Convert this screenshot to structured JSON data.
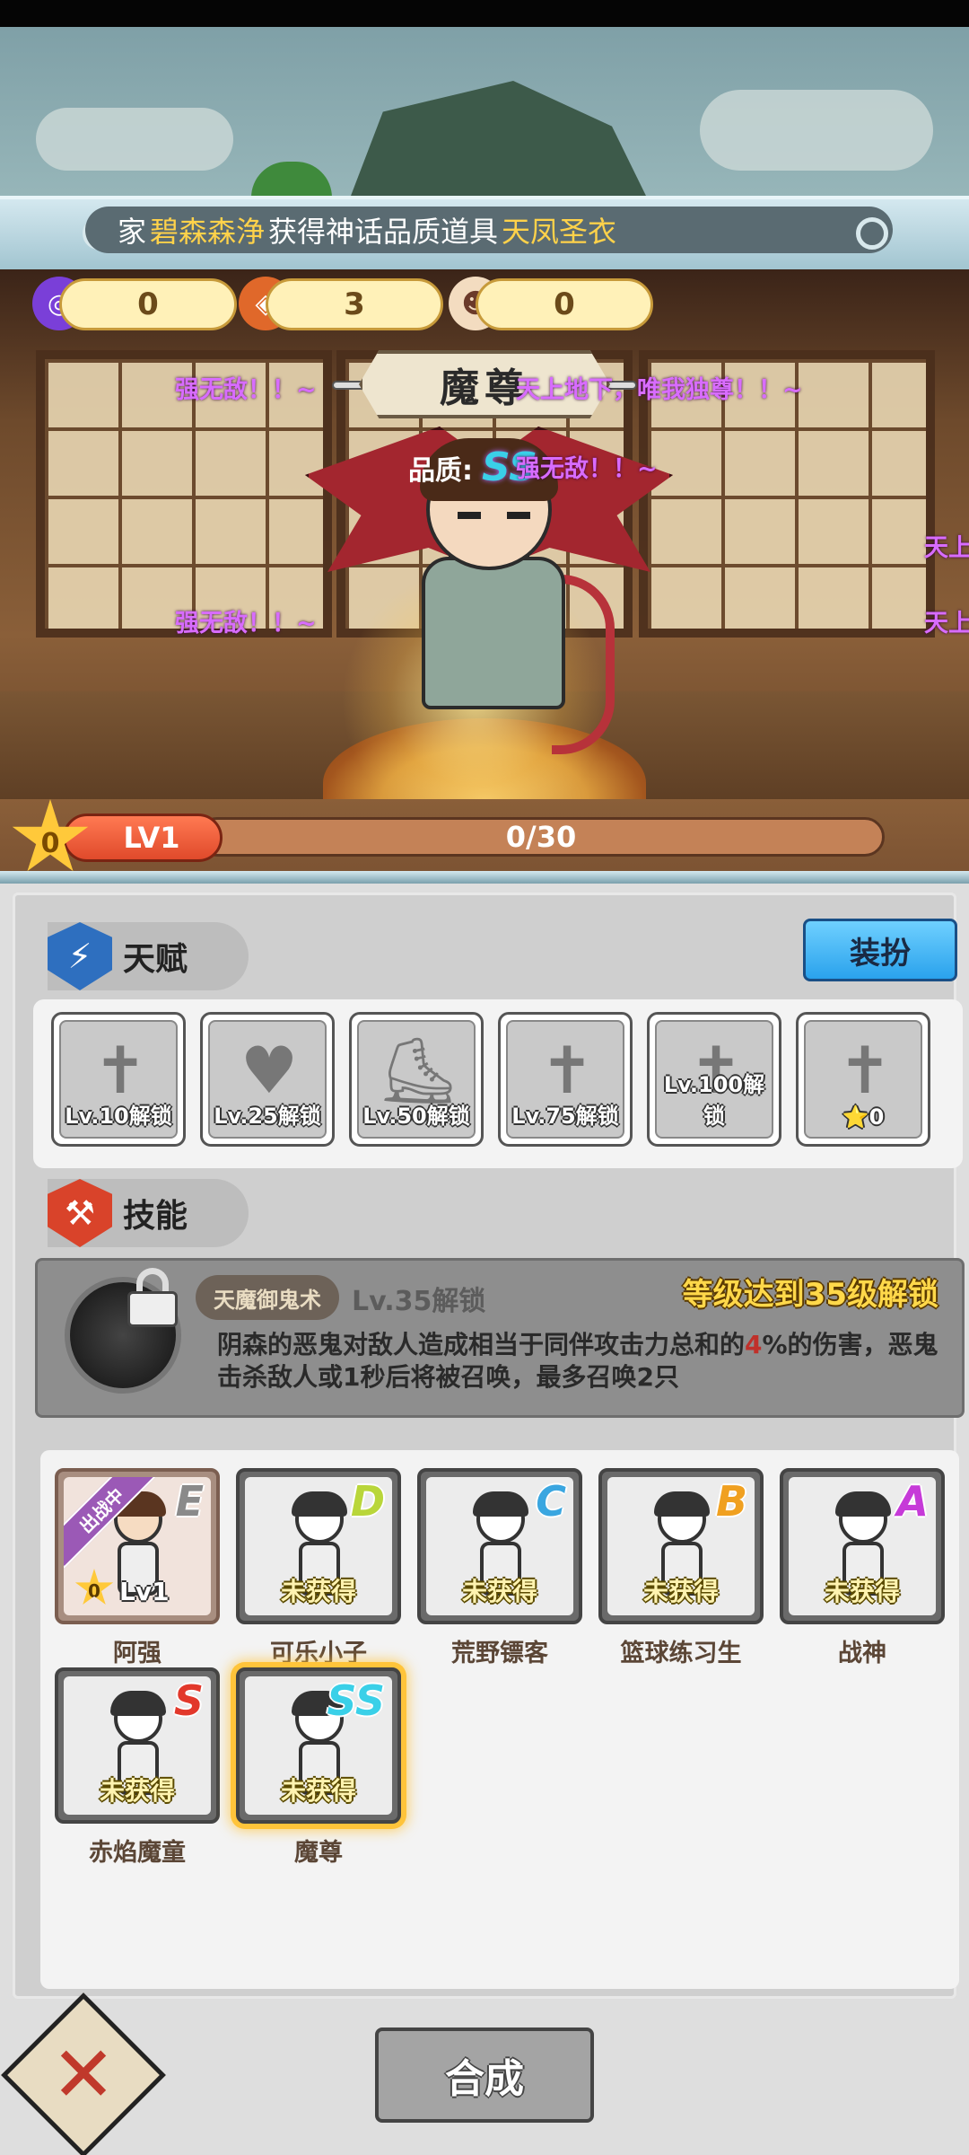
{
  "ticker": {
    "prefix": "家",
    "player": "碧森森浄",
    "middle": "获得神话品质道具",
    "item": "天凤圣衣"
  },
  "currencies": [
    {
      "icon": "purple-orb-icon",
      "value": "0",
      "color": "#7a3fd8"
    },
    {
      "icon": "fire-shell-icon",
      "value": "3",
      "color": "#e0682a"
    },
    {
      "icon": "character-token-icon",
      "value": "0",
      "color": "#f3dcc0"
    }
  ],
  "hero": {
    "name": "魔尊",
    "quality_label": "品质:",
    "quality_grade": "SS"
  },
  "danmaku": [
    "强无敌！！~",
    "天上地下，唯我独尊！！~",
    "强无敌！！~",
    "强无敌！！~",
    "天上",
    "天上"
  ],
  "level": {
    "star_value": "0",
    "label": "LV1",
    "progress_text": "0/30",
    "progress": 0
  },
  "talent": {
    "title": "天赋",
    "dress_button": "装扮",
    "slots": [
      {
        "icon": "sword-icon",
        "label": "Lv.10解锁"
      },
      {
        "icon": "heart-icon",
        "label": "Lv.25解锁"
      },
      {
        "icon": "winged-boot-icon",
        "label": "Lv.50解锁"
      },
      {
        "icon": "sword-icon",
        "label": "Lv.75解锁"
      },
      {
        "icon": "sword-icon",
        "label": "Lv.100解锁"
      },
      {
        "icon": "sword-icon",
        "label": "⭐0"
      }
    ]
  },
  "skill": {
    "title": "技能",
    "name": "天魔御鬼术",
    "unlock_level": "Lv.35解锁",
    "unlock_goal": "等级达到35级解锁",
    "desc_a": "阴森的恶鬼对敌人造成相当于同伴攻击力总和的",
    "desc_num": "4",
    "desc_b": "%的伤害，恶鬼击杀敌人或1秒后将被召唤，最多召唤2只"
  },
  "roster": [
    {
      "name": "阿强",
      "grade": "E",
      "grade_color": "#8a8a8a",
      "state": "",
      "deployed": "出战中",
      "star": "0",
      "lv": "Lv1",
      "active": true
    },
    {
      "name": "可乐小子",
      "grade": "D",
      "grade_color": "#b9d63a",
      "state": "未获得"
    },
    {
      "name": "荒野镖客",
      "grade": "C",
      "grade_color": "#3aa6e0",
      "state": "未获得"
    },
    {
      "name": "篮球练习生",
      "grade": "B",
      "grade_color": "#f0a020",
      "state": "未获得"
    },
    {
      "name": "战神",
      "grade": "A",
      "grade_color": "#c63ad8",
      "state": "未获得"
    },
    {
      "name": "赤焰魔童",
      "grade": "S",
      "grade_color": "#e2382b",
      "state": "未获得"
    },
    {
      "name": "魔尊",
      "grade": "SS",
      "grade_color": "#3ad0e8",
      "state": "未获得",
      "selected": true
    }
  ],
  "footer": {
    "close_icon": "close-x-icon",
    "merge_button": "合成"
  }
}
